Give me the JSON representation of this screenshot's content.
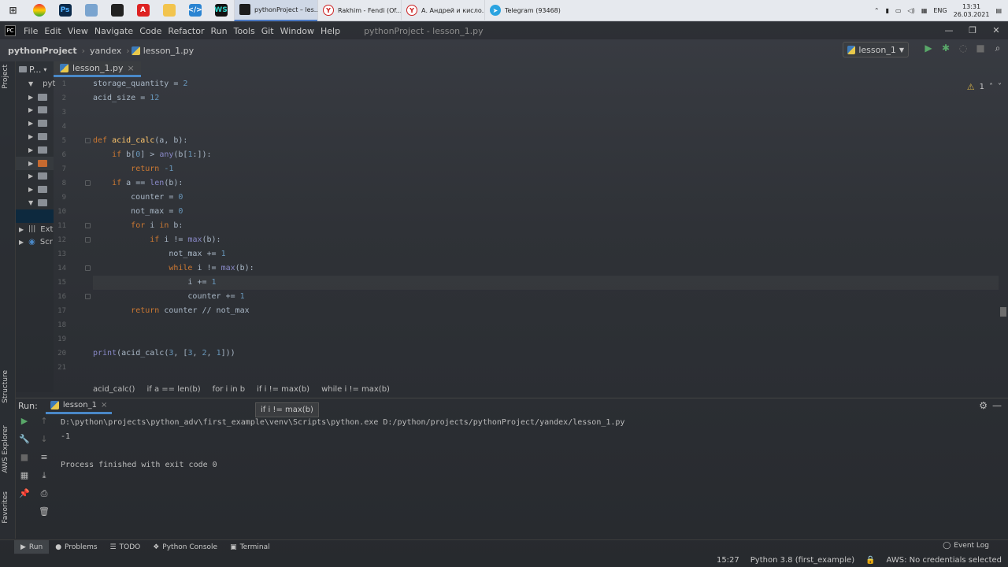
{
  "taskbar": {
    "tasks": [
      {
        "label": "pythonProject – les...",
        "color": "#1c1c1c",
        "glyph": "PC"
      },
      {
        "label": "Rakhim - Fendi (Of...",
        "color": "#cc2222",
        "glyph": "Y"
      },
      {
        "label": "А. Андрей и кисло...",
        "color": "#cc2222",
        "glyph": "Y"
      },
      {
        "label": "Telegram (93468)",
        "color": "#2aa3e0",
        "glyph": "T"
      }
    ],
    "lang": "ENG",
    "time": "13:31",
    "date": "26.03.2021"
  },
  "menu": {
    "items": [
      "File",
      "Edit",
      "View",
      "Navigate",
      "Code",
      "Refactor",
      "Run",
      "Tools",
      "Git",
      "Window",
      "Help"
    ],
    "window_title": "pythonProject - lesson_1.py"
  },
  "nav": {
    "crumbs": [
      "pythonProject",
      "yandex",
      "lesson_1.py"
    ],
    "run_config": "lesson_1"
  },
  "side": {
    "project_tab": "Project",
    "structure_tab": "Structure",
    "aws_tab": "AWS Explorer",
    "favorites_tab": "Favorites"
  },
  "project": {
    "header": "P...",
    "root": "pyt",
    "ext": "Ext",
    "scr": "Scr"
  },
  "editor": {
    "tab": "lesson_1.py",
    "warnings": "1",
    "line_numbers": [
      "1",
      "2",
      "3",
      "4",
      "5",
      "6",
      "7",
      "8",
      "9",
      "10",
      "11",
      "12",
      "13",
      "14",
      "15",
      "16",
      "17",
      "18",
      "19",
      "20",
      "21"
    ],
    "breadcrumbs": [
      "acid_calc()",
      "if a == len(b)",
      "for i in b",
      "if i != max(b)",
      "while i != max(b)"
    ],
    "tooltip": "if i != max(b)"
  },
  "run": {
    "label": "Run:",
    "tab": "lesson_1",
    "console": [
      "D:\\python\\projects\\python_adv\\first_example\\venv\\Scripts\\python.exe D:/python/projects/pythonProject/yandex/lesson_1.py",
      "-1",
      "",
      "Process finished with exit code 0"
    ]
  },
  "bottom": {
    "tools": [
      "Run",
      "Problems",
      "TODO",
      "Python Console",
      "Terminal"
    ],
    "event_log": "Event Log"
  },
  "status": {
    "position": "15:27",
    "interpreter": "Python 3.8 (first_example)",
    "aws": "AWS: No credentials selected"
  }
}
